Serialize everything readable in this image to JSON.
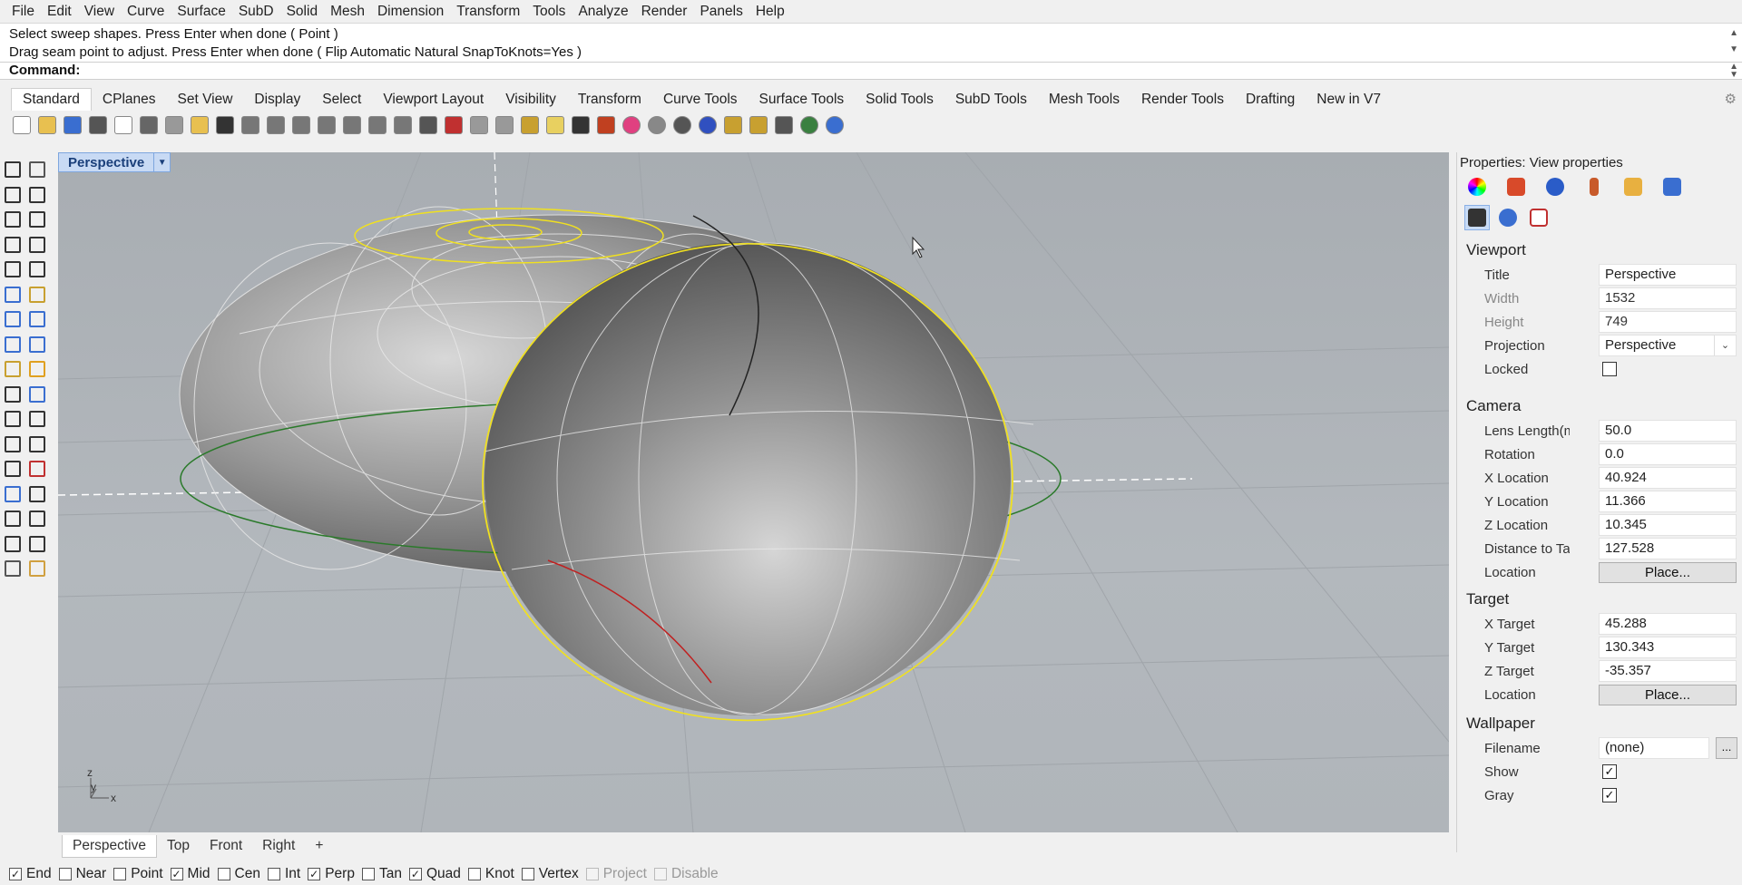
{
  "menu": [
    "File",
    "Edit",
    "View",
    "Curve",
    "Surface",
    "SubD",
    "Solid",
    "Mesh",
    "Dimension",
    "Transform",
    "Tools",
    "Analyze",
    "Render",
    "Panels",
    "Help"
  ],
  "history": {
    "line1": "Select sweep shapes. Press Enter when done ( Point )",
    "line2": "Drag seam point to adjust. Press Enter when done ( Flip  Automatic  Natural  SnapToKnots=Yes )"
  },
  "command": {
    "label": "Command:"
  },
  "toolbar_tabs": [
    "Standard",
    "CPlanes",
    "Set View",
    "Display",
    "Select",
    "Viewport Layout",
    "Visibility",
    "Transform",
    "Curve Tools",
    "Surface Tools",
    "Solid Tools",
    "SubD Tools",
    "Mesh Tools",
    "Render Tools",
    "Drafting",
    "New in V7"
  ],
  "viewport": {
    "title": "Perspective",
    "axis_x": "x",
    "axis_y": "y",
    "axis_z": "z"
  },
  "view_tabs": [
    "Perspective",
    "Top",
    "Front",
    "Right",
    "+"
  ],
  "osnaps": [
    {
      "label": "End",
      "checked": true,
      "enabled": true
    },
    {
      "label": "Near",
      "checked": false,
      "enabled": true
    },
    {
      "label": "Point",
      "checked": false,
      "enabled": true
    },
    {
      "label": "Mid",
      "checked": true,
      "enabled": true
    },
    {
      "label": "Cen",
      "checked": false,
      "enabled": true
    },
    {
      "label": "Int",
      "checked": false,
      "enabled": true
    },
    {
      "label": "Perp",
      "checked": true,
      "enabled": true
    },
    {
      "label": "Tan",
      "checked": false,
      "enabled": true
    },
    {
      "label": "Quad",
      "checked": true,
      "enabled": true
    },
    {
      "label": "Knot",
      "checked": false,
      "enabled": true
    },
    {
      "label": "Vertex",
      "checked": false,
      "enabled": true
    },
    {
      "label": "Project",
      "checked": false,
      "enabled": false
    },
    {
      "label": "Disable",
      "checked": false,
      "enabled": false
    }
  ],
  "properties": {
    "title": "Properties: View properties",
    "viewport_header": "Viewport",
    "title_label": "Title",
    "title_value": "Perspective",
    "width_label": "Width",
    "width_value": "1532",
    "height_label": "Height",
    "height_value": "749",
    "projection_label": "Projection",
    "projection_value": "Perspective",
    "locked_label": "Locked",
    "camera_header": "Camera",
    "lens_label": "Lens Length(mm)",
    "lens_value": "50.0",
    "rotation_label": "Rotation",
    "rotation_value": "0.0",
    "xloc_label": "X Location",
    "xloc_value": "40.924",
    "yloc_label": "Y Location",
    "yloc_value": "11.366",
    "zloc_label": "Z Location",
    "zloc_value": "10.345",
    "dist_label": "Distance to Targ...",
    "dist_value": "127.528",
    "loc_label": "Location",
    "place_label": "Place...",
    "target_header": "Target",
    "xt_label": "X Target",
    "xt_value": "45.288",
    "yt_label": "Y Target",
    "yt_value": "130.343",
    "zt_label": "Z Target",
    "zt_value": "-35.357",
    "tloc_label": "Location",
    "tplace_label": "Place...",
    "wallpaper_header": "Wallpaper",
    "filename_label": "Filename",
    "filename_value": "(none)",
    "ellipsis": "...",
    "show_label": "Show",
    "gray_label": "Gray"
  },
  "colors": {
    "selection_yellow": "#f0e020",
    "viewport_bg": "#adb2b7",
    "active_tab_blue": "#c8daf4"
  }
}
